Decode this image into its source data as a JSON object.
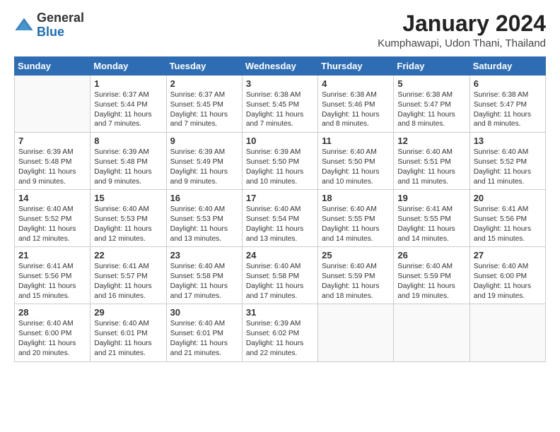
{
  "header": {
    "logo": {
      "general": "General",
      "blue": "Blue"
    },
    "title": "January 2024",
    "subtitle": "Kumphawapi, Udon Thani, Thailand"
  },
  "calendar": {
    "days_of_week": [
      "Sunday",
      "Monday",
      "Tuesday",
      "Wednesday",
      "Thursday",
      "Friday",
      "Saturday"
    ],
    "weeks": [
      [
        {
          "day": "",
          "info": ""
        },
        {
          "day": "1",
          "info": "Sunrise: 6:37 AM\nSunset: 5:44 PM\nDaylight: 11 hours\nand 7 minutes."
        },
        {
          "day": "2",
          "info": "Sunrise: 6:37 AM\nSunset: 5:45 PM\nDaylight: 11 hours\nand 7 minutes."
        },
        {
          "day": "3",
          "info": "Sunrise: 6:38 AM\nSunset: 5:45 PM\nDaylight: 11 hours\nand 7 minutes."
        },
        {
          "day": "4",
          "info": "Sunrise: 6:38 AM\nSunset: 5:46 PM\nDaylight: 11 hours\nand 8 minutes."
        },
        {
          "day": "5",
          "info": "Sunrise: 6:38 AM\nSunset: 5:47 PM\nDaylight: 11 hours\nand 8 minutes."
        },
        {
          "day": "6",
          "info": "Sunrise: 6:38 AM\nSunset: 5:47 PM\nDaylight: 11 hours\nand 8 minutes."
        }
      ],
      [
        {
          "day": "7",
          "info": "Sunrise: 6:39 AM\nSunset: 5:48 PM\nDaylight: 11 hours\nand 9 minutes."
        },
        {
          "day": "8",
          "info": "Sunrise: 6:39 AM\nSunset: 5:48 PM\nDaylight: 11 hours\nand 9 minutes."
        },
        {
          "day": "9",
          "info": "Sunrise: 6:39 AM\nSunset: 5:49 PM\nDaylight: 11 hours\nand 9 minutes."
        },
        {
          "day": "10",
          "info": "Sunrise: 6:39 AM\nSunset: 5:50 PM\nDaylight: 11 hours\nand 10 minutes."
        },
        {
          "day": "11",
          "info": "Sunrise: 6:40 AM\nSunset: 5:50 PM\nDaylight: 11 hours\nand 10 minutes."
        },
        {
          "day": "12",
          "info": "Sunrise: 6:40 AM\nSunset: 5:51 PM\nDaylight: 11 hours\nand 11 minutes."
        },
        {
          "day": "13",
          "info": "Sunrise: 6:40 AM\nSunset: 5:52 PM\nDaylight: 11 hours\nand 11 minutes."
        }
      ],
      [
        {
          "day": "14",
          "info": "Sunrise: 6:40 AM\nSunset: 5:52 PM\nDaylight: 11 hours\nand 12 minutes."
        },
        {
          "day": "15",
          "info": "Sunrise: 6:40 AM\nSunset: 5:53 PM\nDaylight: 11 hours\nand 12 minutes."
        },
        {
          "day": "16",
          "info": "Sunrise: 6:40 AM\nSunset: 5:53 PM\nDaylight: 11 hours\nand 13 minutes."
        },
        {
          "day": "17",
          "info": "Sunrise: 6:40 AM\nSunset: 5:54 PM\nDaylight: 11 hours\nand 13 minutes."
        },
        {
          "day": "18",
          "info": "Sunrise: 6:40 AM\nSunset: 5:55 PM\nDaylight: 11 hours\nand 14 minutes."
        },
        {
          "day": "19",
          "info": "Sunrise: 6:41 AM\nSunset: 5:55 PM\nDaylight: 11 hours\nand 14 minutes."
        },
        {
          "day": "20",
          "info": "Sunrise: 6:41 AM\nSunset: 5:56 PM\nDaylight: 11 hours\nand 15 minutes."
        }
      ],
      [
        {
          "day": "21",
          "info": "Sunrise: 6:41 AM\nSunset: 5:56 PM\nDaylight: 11 hours\nand 15 minutes."
        },
        {
          "day": "22",
          "info": "Sunrise: 6:41 AM\nSunset: 5:57 PM\nDaylight: 11 hours\nand 16 minutes."
        },
        {
          "day": "23",
          "info": "Sunrise: 6:40 AM\nSunset: 5:58 PM\nDaylight: 11 hours\nand 17 minutes."
        },
        {
          "day": "24",
          "info": "Sunrise: 6:40 AM\nSunset: 5:58 PM\nDaylight: 11 hours\nand 17 minutes."
        },
        {
          "day": "25",
          "info": "Sunrise: 6:40 AM\nSunset: 5:59 PM\nDaylight: 11 hours\nand 18 minutes."
        },
        {
          "day": "26",
          "info": "Sunrise: 6:40 AM\nSunset: 5:59 PM\nDaylight: 11 hours\nand 19 minutes."
        },
        {
          "day": "27",
          "info": "Sunrise: 6:40 AM\nSunset: 6:00 PM\nDaylight: 11 hours\nand 19 minutes."
        }
      ],
      [
        {
          "day": "28",
          "info": "Sunrise: 6:40 AM\nSunset: 6:00 PM\nDaylight: 11 hours\nand 20 minutes."
        },
        {
          "day": "29",
          "info": "Sunrise: 6:40 AM\nSunset: 6:01 PM\nDaylight: 11 hours\nand 21 minutes."
        },
        {
          "day": "30",
          "info": "Sunrise: 6:40 AM\nSunset: 6:01 PM\nDaylight: 11 hours\nand 21 minutes."
        },
        {
          "day": "31",
          "info": "Sunrise: 6:39 AM\nSunset: 6:02 PM\nDaylight: 11 hours\nand 22 minutes."
        },
        {
          "day": "",
          "info": ""
        },
        {
          "day": "",
          "info": ""
        },
        {
          "day": "",
          "info": ""
        }
      ]
    ]
  }
}
